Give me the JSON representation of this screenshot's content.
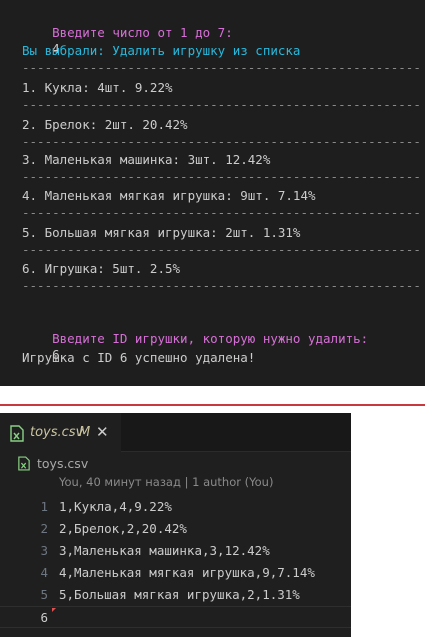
{
  "terminal": {
    "prompt_choice": "Введите число от 1 до 7:",
    "choice_value": "4",
    "selected": "Вы выбрали: Удалить игрушку из списка",
    "separator": "--------------------------------------------------------------",
    "items": [
      "1. Кукла: 4шт. 9.22%",
      "2. Брелок: 2шт. 20.42%",
      "3. Маленькая машинка: 3шт. 12.42%",
      "4. Маленькая мягкая игрушка: 9шт. 7.14%",
      "5. Большая мягкая игрушка: 2шт. 1.31%",
      "6. Игрушка: 5шт. 2.5%"
    ],
    "prompt_id": "Введите ID игрушки, которую нужно удалить:",
    "id_value": "6",
    "result": "Игрушка с ID 6 успешно удалена!"
  },
  "editor": {
    "tab": {
      "name": "toys.csv",
      "modified": "M",
      "close": "✕"
    },
    "breadcrumb": "toys.csv",
    "blame": "You, 40 минут назад | 1 author (You)",
    "lines": [
      {
        "num": "1",
        "text": "1,Кукла,4,9.22%"
      },
      {
        "num": "2",
        "text": "2,Брелок,2,20.42%"
      },
      {
        "num": "3",
        "text": "3,Маленькая машинка,3,12.42%"
      },
      {
        "num": "4",
        "text": "4,Маленькая мягкая игрушка,9,7.14%"
      },
      {
        "num": "5",
        "text": "5,Большая мягкая игрушка,2,1.31%"
      },
      {
        "num": "6",
        "text": ""
      }
    ]
  },
  "colors": {
    "terminal_bg": "#1e1e1e",
    "prompt": "#d670d6",
    "info": "#29b8db",
    "divider": "#c8383f",
    "editor_bg": "#1f1f1f"
  },
  "icons": {
    "file": "csv-file-icon",
    "close": "close-icon"
  }
}
